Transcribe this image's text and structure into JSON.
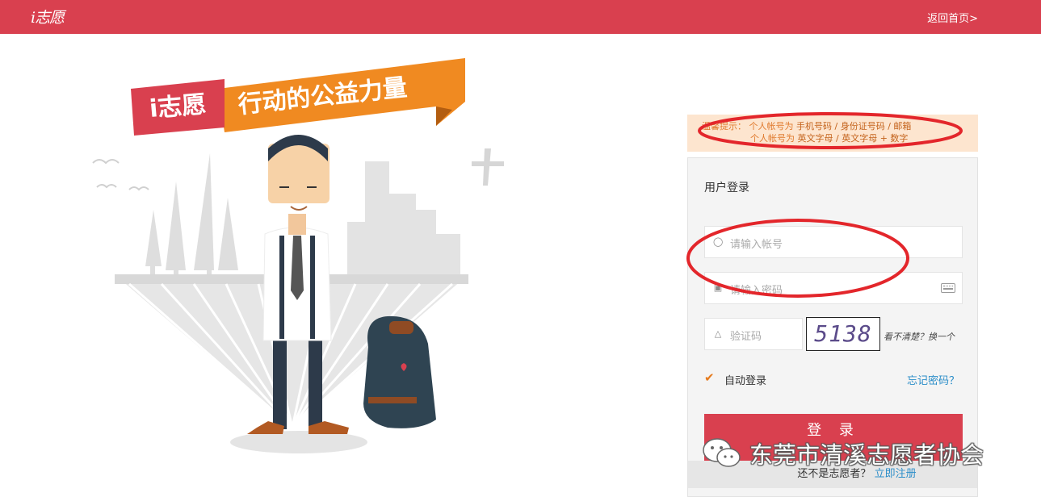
{
  "header": {
    "logo_text": "i志愿",
    "home_link": "返回首页>"
  },
  "banner": {
    "badge": "i志愿",
    "slogan": "行动的公益力量"
  },
  "tip": {
    "line1_prefix": "温馨提示：",
    "line1_a": "个人帐号为",
    "line1_b": "手机号码 / 身份证号码 / 邮箱",
    "line2_a": "个人帐号为",
    "line2_b": "英文字母 / 英文字母 + 数字"
  },
  "login": {
    "title": "用户登录",
    "account_placeholder": "请输入帐号",
    "password_placeholder": "请输入密码",
    "captcha_placeholder": "验证码",
    "captcha_value": "5138",
    "refresh_text": "看不清楚？换一个",
    "auto_login": "自动登录",
    "auto_login_checked": true,
    "forgot": "忘记密码？",
    "submit": "登 录",
    "register_prompt": "还不是志愿者？",
    "register_link": "立即注册"
  },
  "watermark": {
    "text": "东莞市清溪志愿者协会"
  },
  "colors": {
    "brand_red": "#d9404f",
    "accent_orange": "#f08a21",
    "link_blue": "#2c8ec9",
    "annotation_red": "#e3262b"
  },
  "icons": [
    "logo-icon",
    "user-icon",
    "lock-icon",
    "keyboard-icon",
    "shield-icon",
    "checkmark-icon",
    "wechat-icon"
  ]
}
